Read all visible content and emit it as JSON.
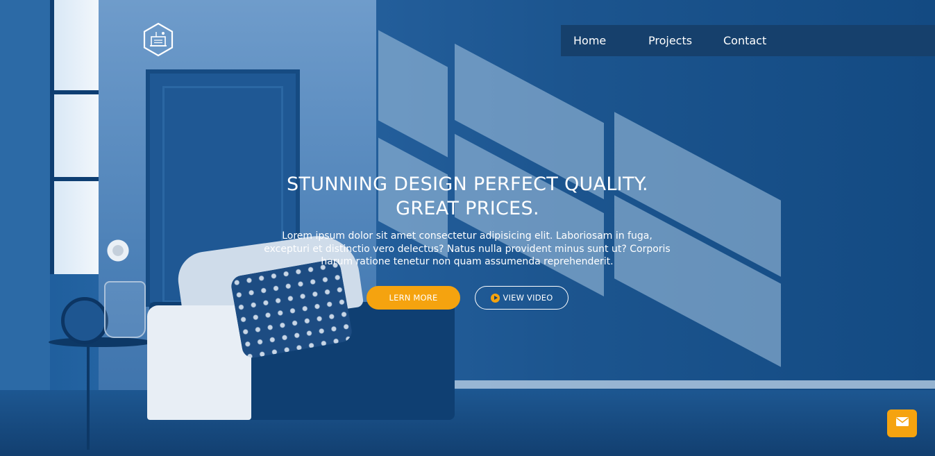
{
  "nav": {
    "items": [
      {
        "label": "Home"
      },
      {
        "label": "Projects"
      },
      {
        "label": "Contact"
      }
    ]
  },
  "hero": {
    "headline_line1": "STUNNING DESIGN PERFECT QUALITY.",
    "headline_line2": "GREAT PRICES.",
    "lead": "Lorem ipsum dolor sit amet consectetur adipisicing elit. Laboriosam in fuga, excepturi et distinctio vero delectus? Natus nulla provident minus sunt ut? Corporis harum ratione tenetur non quam assumenda reprehenderit.",
    "primary_button": "LERN MORE",
    "video_button": "VIEW VIDEO"
  },
  "icons": {
    "logo": "hexagon-logo-icon",
    "play": "play-icon",
    "mail": "envelope-icon"
  },
  "colors": {
    "accent": "#f5a30f",
    "nav_background": "#16406c",
    "overlay_blue": "#1a4f88"
  }
}
